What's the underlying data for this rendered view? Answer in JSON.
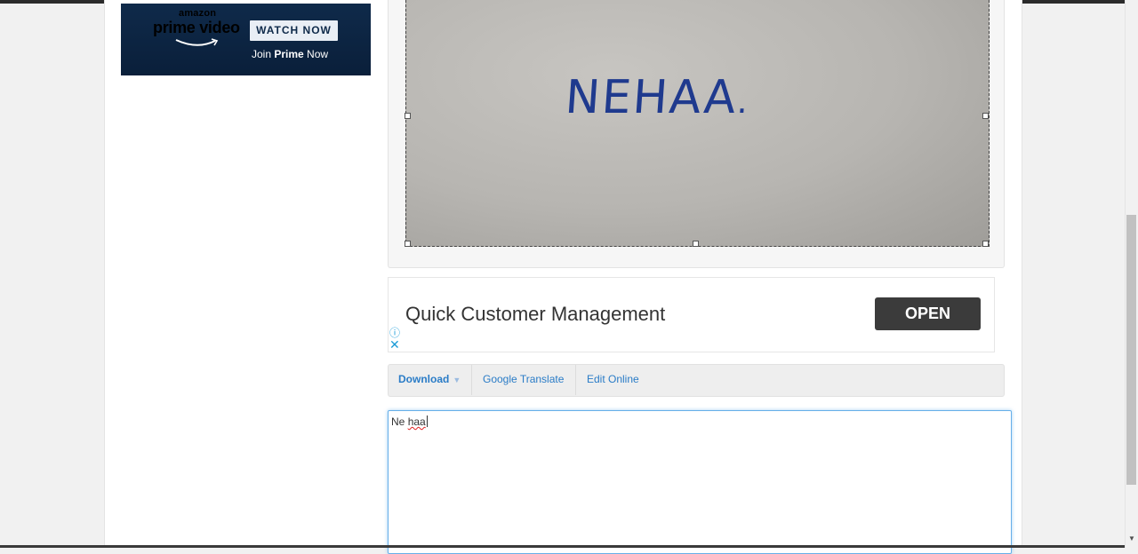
{
  "amazon_ad": {
    "brand": "amazon",
    "product": "prime video",
    "watch_label": "WATCH NOW",
    "join_prefix": "Join ",
    "join_bold": "Prime",
    "join_suffix": " Now"
  },
  "image_panel": {
    "handwriting_main": "NEHAA",
    "handwriting_dot": "."
  },
  "text_ad": {
    "title": "Quick Customer Management",
    "cta": "OPEN",
    "info_icon": "ⓘ",
    "close_icon": "✕"
  },
  "toolbar": {
    "download": "Download",
    "google_translate": "Google Translate",
    "edit_online": "Edit Online"
  },
  "result": {
    "word1": "Ne ",
    "word2": "haa"
  },
  "colors": {
    "link": "#2a7cc7",
    "focus_border": "#66afe9",
    "ad_button": "#3b3b3b"
  }
}
